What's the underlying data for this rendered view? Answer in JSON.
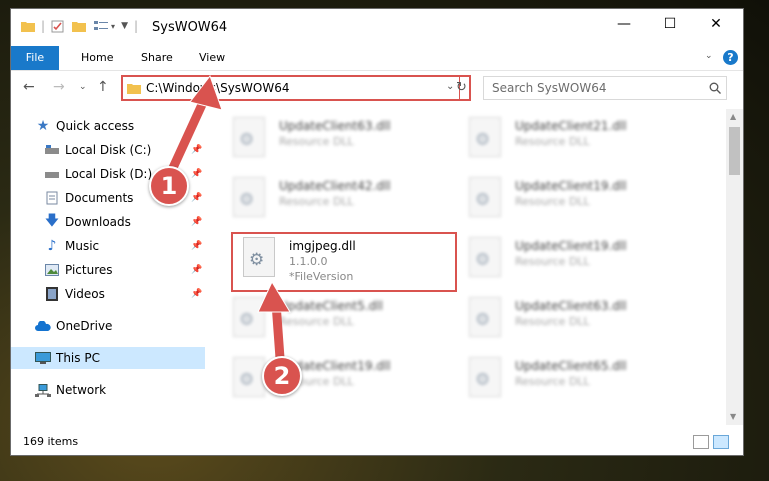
{
  "window": {
    "title": "SysWOW64",
    "controls": {
      "minimize": "—",
      "maximize": "☐",
      "close": "✕"
    }
  },
  "ribbon": {
    "tabs": [
      "File",
      "Home",
      "Share",
      "View"
    ],
    "help": "?"
  },
  "address": {
    "path": "C:\\Windows\\SysWOW64",
    "search_placeholder": "Search SysWOW64"
  },
  "sidebar": {
    "items": [
      {
        "label": "Quick access",
        "icon": "star-icon"
      },
      {
        "label": "Local Disk (C:)",
        "icon": "drive-icon"
      },
      {
        "label": "Local Disk (D:)",
        "icon": "drive-icon"
      },
      {
        "label": "Documents",
        "icon": "documents-icon"
      },
      {
        "label": "Downloads",
        "icon": "download-icon"
      },
      {
        "label": "Music",
        "icon": "music-icon"
      },
      {
        "label": "Pictures",
        "icon": "pictures-icon"
      },
      {
        "label": "Videos",
        "icon": "videos-icon"
      },
      {
        "label": "OneDrive",
        "icon": "cloud-icon"
      },
      {
        "label": "This PC",
        "icon": "computer-icon"
      },
      {
        "label": "Network",
        "icon": "network-icon"
      }
    ]
  },
  "files": [
    {
      "name": "UpdateClient63.dll",
      "desc": "Resource DLL"
    },
    {
      "name": "UpdateClient21.dll",
      "desc": "Resource DLL"
    },
    {
      "name": "UpdateClient42.dll",
      "desc": "Resource DLL"
    },
    {
      "name": "UpdateClient19.dll",
      "desc": "Resource DLL"
    },
    {
      "name": "imgjpeg.dll",
      "desc": "1.1.0.0",
      "desc2": "*FileVersion"
    },
    {
      "name": "UpdateClient19.dll",
      "desc": "Resource DLL"
    },
    {
      "name": "UpdateClient5.dll",
      "desc": "Resource DLL"
    },
    {
      "name": "UpdateClient63.dll",
      "desc": "Resource DLL"
    },
    {
      "name": "UpdateClient19.dll",
      "desc": "Resource DLL"
    },
    {
      "name": "UpdateClient65.dll",
      "desc": "Resource DLL"
    }
  ],
  "status": {
    "count": "169 items"
  },
  "annotations": {
    "step1": "1",
    "step2": "2"
  },
  "colors": {
    "accent": "#1979ca",
    "annotation": "#d9534f",
    "selected": "#cce8ff"
  }
}
